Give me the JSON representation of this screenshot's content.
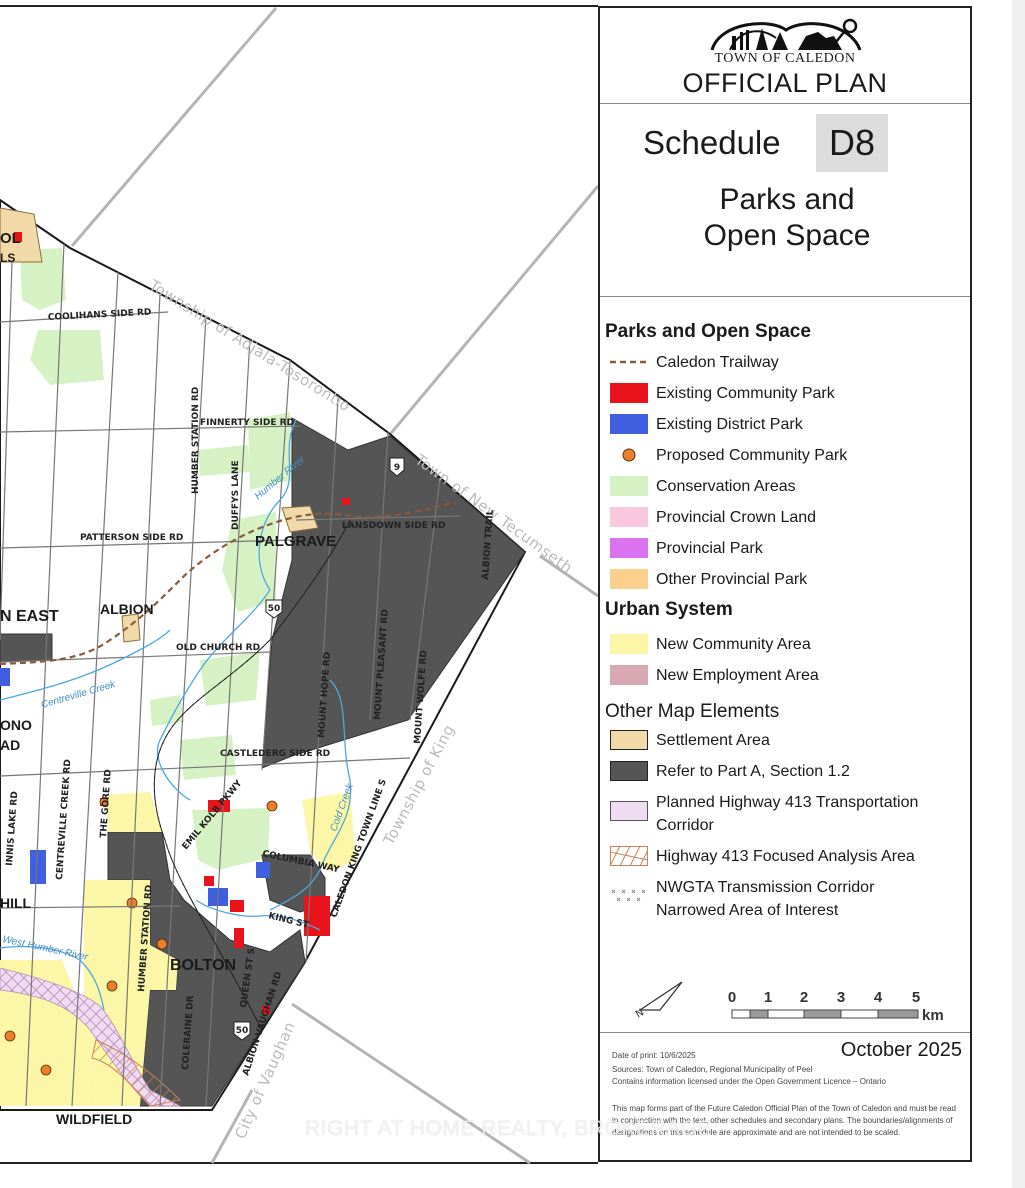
{
  "map": {
    "settlements": [
      "PALGRAVE",
      "ALBION",
      "BOLTON",
      "WILDFIELD",
      "N EAST",
      "HILL",
      "ONO",
      "AD",
      "OL",
      "LS"
    ],
    "roads": [
      "COOLIHANS SIDE RD",
      "FINNERTY SIDE RD",
      "PATTERSON SIDE RD",
      "OLD CHURCH RD",
      "CASTLEDERG SIDE RD",
      "HUMBER STATION RD",
      "DUFFYS LANE",
      "MOUNT HOPE RD",
      "MOUNT PLEASANT RD",
      "MOUNT WOLFE RD",
      "ALBION TRAIL",
      "CENTREVILLE CREEK RD",
      "INNIS LAKE RD",
      "THE GORE RD",
      "COLERAINE DR",
      "ALBION VAUGHAN RD",
      "EMIL KOLB PKWY",
      "COLUMBIA WAY",
      "KING ST",
      "QUEEN ST S",
      "CALEDON KING TOWN LINE S",
      "HUMBER STATION RD",
      "LANSDOWN SIDE RD"
    ],
    "water": [
      "Humber River",
      "Centreville Creek",
      "Cold Creek",
      "West Humber River"
    ],
    "highways": [
      "9",
      "50",
      "50"
    ],
    "boundaries": [
      "Township of Adjala-Tosorontio",
      "Town of New Tecumseth",
      "Township of King",
      "City of Vaughan"
    ]
  },
  "header": {
    "town": "TOWN OF CALEDON",
    "title": "OFFICIAL PLAN"
  },
  "schedule": {
    "label": "Schedule",
    "number": "D8",
    "subtitle_line1": "Parks and",
    "subtitle_line2": "Open Space"
  },
  "legend": {
    "parks_heading": "Parks and Open Space",
    "parks": [
      {
        "label": "Caledon Trailway",
        "color": "#8B5A3C",
        "style": "dash"
      },
      {
        "label": "Existing Community Park",
        "color": "#E8131B",
        "style": "fill"
      },
      {
        "label": "Existing District Park",
        "color": "#3F5FE0",
        "style": "fill"
      },
      {
        "label": "Proposed Community Park",
        "color": "#E8812A",
        "style": "dot"
      },
      {
        "label": "Conservation Areas",
        "color": "#D6F2C4",
        "style": "fill"
      },
      {
        "label": "Provincial Crown Land",
        "color": "#F9C7DE",
        "style": "fill"
      },
      {
        "label": "Provincial Park",
        "color": "#DB73F0",
        "style": "fill"
      },
      {
        "label": "Other Provincial Park",
        "color": "#FAD08C",
        "style": "fill"
      }
    ],
    "urban_heading": "Urban System",
    "urban": [
      {
        "label": "New Community Area",
        "color": "#FBF7A6",
        "style": "fill"
      },
      {
        "label": "New Employment Area",
        "color": "#D9A9B3",
        "style": "fill"
      }
    ],
    "other_heading": "Other Map Elements",
    "other": [
      {
        "label": "Settlement Area",
        "color": "#F2D9A8",
        "style": "outline"
      },
      {
        "label": "Refer to Part A, Section 1.2",
        "color": "#555555",
        "style": "outline"
      },
      {
        "label": "Planned Highway 413 Transportation",
        "label2": "Corridor",
        "color": "#F0DCF2",
        "style": "outline"
      },
      {
        "label": "Highway 413 Focused Analysis Area",
        "color": "#C8825A",
        "style": "hatch"
      },
      {
        "label": "NWGTA Transmission Corridor",
        "label2": "Narrowed Area of Interest",
        "color": "#888888",
        "style": "cross"
      }
    ]
  },
  "scale": {
    "ticks": [
      "0",
      "1",
      "2",
      "3",
      "4",
      "5"
    ],
    "unit": "km"
  },
  "footer": {
    "print_date": "Date of print: 10/6/2025",
    "month": "October 2025",
    "sources_line1": "Sources: Town of Caledon, Regional Municipality of Peel",
    "sources_line2": "Contains information licensed under the Open Government Licence – Ontario",
    "disclaimer": "This map forms part of the Future Caledon Official Plan of the Town of Caledon and must be read in conjunction with the text, other schedules and secondary plans. The boundaries/alignments of designations on this schedule are approximate and are not intended to be scaled."
  },
  "watermark": "RIGHT AT HOME REALTY, BROKERAGE"
}
